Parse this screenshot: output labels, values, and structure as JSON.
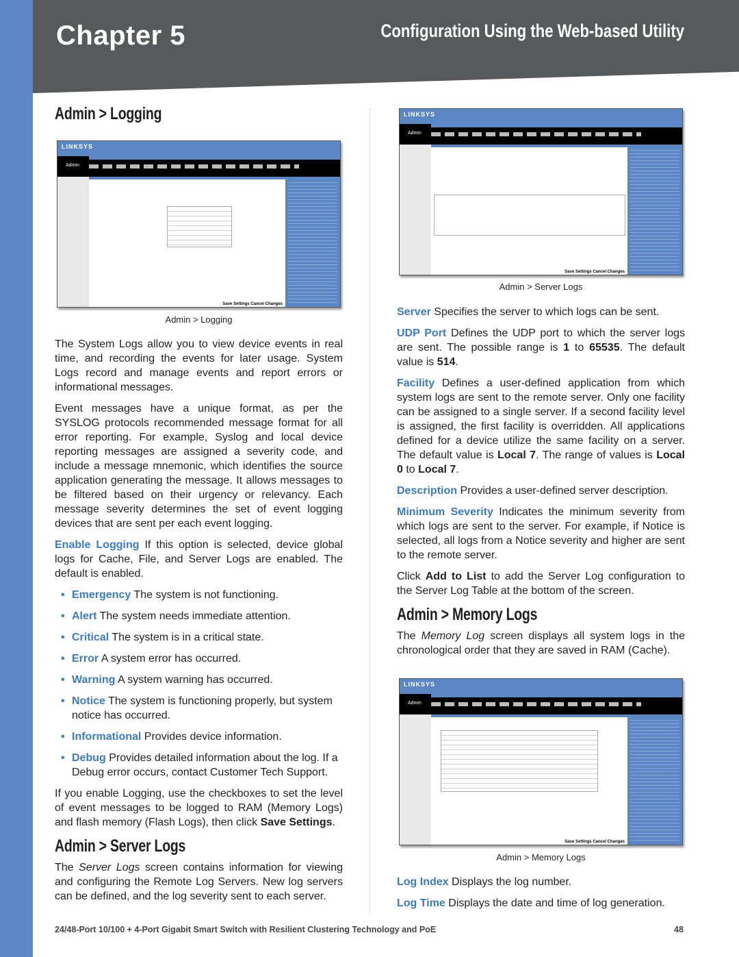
{
  "header": {
    "chapter": "Chapter 5",
    "title": "Configuration Using the Web-based Utility"
  },
  "left": {
    "h1": "Admin > Logging",
    "shot1": {
      "admin": "Admin",
      "buttons": "Save Settings  Cancel Changes"
    },
    "cap1": "Admin > Logging",
    "p1": "The System Logs allow you to view device events in real time, and recording the events for later usage. System Logs record and manage events and report errors or informational messages.",
    "p2": "Event messages have a unique format, as per the SYSLOG protocols recommended message format for all error reporting. For example, Syslog and local device reporting messages are assigned a severity code, and include a message mnemonic, which identifies the source application generating the message. It allows messages to be filtered based on their urgency or relevancy. Each message severity determines the set of event logging devices that are sent per each event logging.",
    "p3": {
      "term": "Enable Logging",
      "text": " If this option is selected, device global logs for Cache, File, and Server Logs are enabled. The default is enabled."
    },
    "bullets": [
      {
        "term": "Emergency",
        "text": " The system is not functioning."
      },
      {
        "term": "Alert",
        "text": " The system needs immediate attention."
      },
      {
        "term": "Critical",
        "text": " The system is in a critical state."
      },
      {
        "term": "Error",
        "text": " A system error has occurred."
      },
      {
        "term": "Warning",
        "text": " A system warning has occurred."
      },
      {
        "term": "Notice",
        "text": " The system is functioning properly, but system notice has occurred."
      },
      {
        "term": "Informational",
        "text": " Provides device information."
      },
      {
        "term": "Debug",
        "text": " Provides detailed information about the log. If a Debug error occurs, contact Customer Tech Support."
      }
    ],
    "p4": {
      "a": "If you enable Logging, use the checkboxes to set the level of event messages to be logged to RAM (Memory Logs) and flash memory (Flash Logs), then click ",
      "b": "Save Settings",
      "c": "."
    },
    "h2": "Admin > Server Logs",
    "p5": {
      "a": "The ",
      "i": "Server Logs",
      "c": " screen contains information for viewing and configuring the Remote Log Servers. New log servers can be defined, and the log severity sent to each server."
    }
  },
  "right": {
    "shot2": {
      "admin": "Admin",
      "buttons": "Save Settings  Cancel Changes"
    },
    "cap2": "Admin > Server Logs",
    "server": {
      "term": "Server",
      "text": " Specifies the server to which logs can be sent."
    },
    "udp": {
      "term": "UDP Port",
      "a": " Defines the UDP port to which the server logs are sent. The possible range is ",
      "b1": "1",
      "m": " to ",
      "b2": "65535",
      "n": ". The default value is ",
      "b3": "514",
      "e": "."
    },
    "facility": {
      "term": "Facility",
      "a": " Defines a user-defined application from which system logs are sent to the remote server. Only one facility can be assigned to a single server. If a second facility level is assigned, the first facility is overridden. All applications defined for a device utilize the same facility on a server. The default value is ",
      "b1": "Local 7",
      "m": ". The range of values is ",
      "b2": "Local 0",
      "n": " to ",
      "b3": "Local 7",
      "e": "."
    },
    "description": {
      "term": "Description",
      "text": " Provides a user-defined server description."
    },
    "minsev": {
      "term": "Minimum Severity",
      "text": " Indicates the minimum severity from which logs are sent to the server. For example, if Notice is selected, all logs from a Notice severity and higher are sent to the remote server."
    },
    "click": {
      "a": "Click ",
      "b": "Add to List",
      "c": " to add the Server Log configuration to the Server Log Table at the bottom of the screen."
    },
    "h3": "Admin > Memory Logs",
    "mem": {
      "a": "The ",
      "i": "Memory Log",
      "c": " screen displays all system logs in the chronological order that they are saved in RAM (Cache)."
    },
    "shot3": {
      "admin": "Admin",
      "buttons": "Save Settings  Cancel Changes"
    },
    "cap3": "Admin > Memory Logs",
    "logindex": {
      "term": "Log Index",
      "text": " Displays the log number."
    },
    "logtime": {
      "term": "Log Time",
      "text": " Displays the date and time of log generation."
    }
  },
  "footer": {
    "text": "24/48-Port 10/100 + 4-Port Gigabit Smart Switch with Resilient Clustering Technology and PoE",
    "page": "48"
  },
  "colors": {
    "accent": "#3a7cc4",
    "strip": "#5b87c6",
    "header": "#58595b"
  }
}
